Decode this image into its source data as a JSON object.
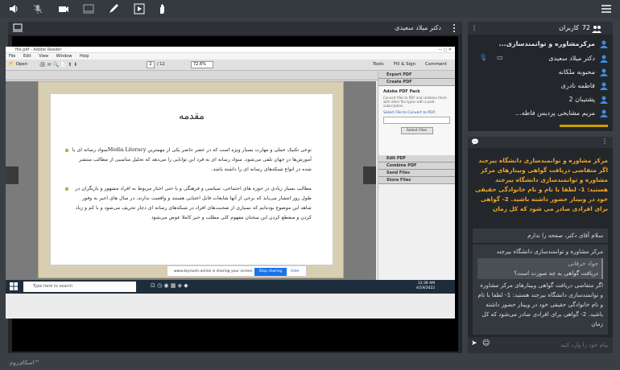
{
  "topbar": {
    "icons": [
      "speaker-icon",
      "mic-muted-icon",
      "camera-icon",
      "screen-icon",
      "pen-icon",
      "play-icon",
      "hand-icon",
      "menu-icon"
    ]
  },
  "main": {
    "presenter_name": "دکتر میلاد سعیدی",
    "reader": {
      "title": "file.pdf - Adobe Reader",
      "menus": [
        "File",
        "Edit",
        "View",
        "Window",
        "Help"
      ],
      "open_label": "Open",
      "page_current": "2",
      "page_total": "/ 12",
      "zoom": "72.6%",
      "tools_label": "Tools",
      "fill_sign_label": "Fill & Sign",
      "comment_label": "Comment",
      "sign_in_label": "Sign In",
      "pane": {
        "export_pdf": "Export PDF",
        "create_pdf": "Create PDF",
        "pack_title": "Adobe PDF Pack",
        "pack_desc": "Convert files to PDF and combine them with other file types with a paid subscription.",
        "select_label": "Select File to Convert to PDF:",
        "select_button": "Select Files",
        "edit_pdf": "Edit PDF",
        "combine_pdf": "Combine PDF",
        "send_files": "Send Files",
        "store_files": "Store Files"
      },
      "doc": {
        "title": "مقدمه",
        "para1": "نوعی تکنیک عملی و مهارت بسیار ویژه است که در عصر حاضر یکی از مهمترین Media Literacyسواد رسانه ای یا آموزش‌ها در جهان تلقی می‌شود. سواد رسانه ای به فرد این توانایی را می‌دهد که تحلیل مناسبی از مطالب منتشر شده در انواع شبکه‌های رسانه ای را داشته باشد.",
        "para2": "مطالب بسیار زیادی در حوزه های اجتماعی، سیاسی و فرهنگی و یا حتی اخبار مربوط به افراد مشهور و بازیگران در طول روز انتشار می‌یابد که برخی از آنها شایعات قابل اعتنایی هستند و واقعیت ندارند. در سال های اخیر به وفور شاهد این موضوع بوده‌ایم که بسیاری از صحبت‌های افراد در شبکه‌های رسانه ای دچار تحریف می‌شود و با کم و زیاد کردن و منقطع کردن این سخنان مفهوم کلی مطلب و خبر کاملا عوض می‌شود"
      },
      "share_text": "www.skyroom.online is sharing your screen.",
      "stop_sharing": "Stop sharing",
      "hide": "Hide",
      "search_placeholder": "Type here to search",
      "clock_time": "12:39 AM",
      "clock_date": "4/19/2022"
    }
  },
  "users": {
    "header": "کاربران",
    "count": "72",
    "list": [
      {
        "name": "مرکزمشاوره و توانمندسازی..."
      },
      {
        "name": "دکتر میلاد سعیدی"
      },
      {
        "name": "محبوبه ملکانه"
      },
      {
        "name": "فاطمه نادری"
      },
      {
        "name": "پشتیبان 2"
      },
      {
        "name": "مریم مشایخی پردیس فاطه..."
      }
    ]
  },
  "chat": {
    "msg1": "مرکز مشاوره و توانمندسازی دانشگاه بیرجند اگر متقاضی دریافت گواهی وبینارهای مرکز مشاوره و توانمندسازی دانشگاه بیرجند هستید: 1- لطفا با نام و نام خانوادگی حقیقی خود در وبینار حضور داشته باشید. 2- گواهی برای افرادی صادر می شود که کل زمان",
    "msg2": "سلام آقای دکتر، صفحه را ندارم",
    "msg3_sender": "مرکز مشاوره و توانمندسازی دانشگاه بیرجند",
    "msg3_quote_name": "جواد خرقانی",
    "msg3_quote_text": "دریافت گواهی به چه صورت است؟",
    "msg3_body": "اگر متقاضی دریافت گواهی وبینارهای مرکز مشاوره و توانمندسازی دانشگاه بیرجند هستید: 1- لطفا با نام و نام خانوادگی حقیقی خود در وبینار حضور داشته باشید. 2- گواهی برای افرادی صادر می‌شود که کل زمان",
    "input_placeholder": "پیام خود را وارد کنید"
  },
  "footer": {
    "brand": "اسکای‌روم™"
  },
  "colors": {
    "highlight": "#f5a623",
    "accent_blue": "#3c8dde"
  }
}
